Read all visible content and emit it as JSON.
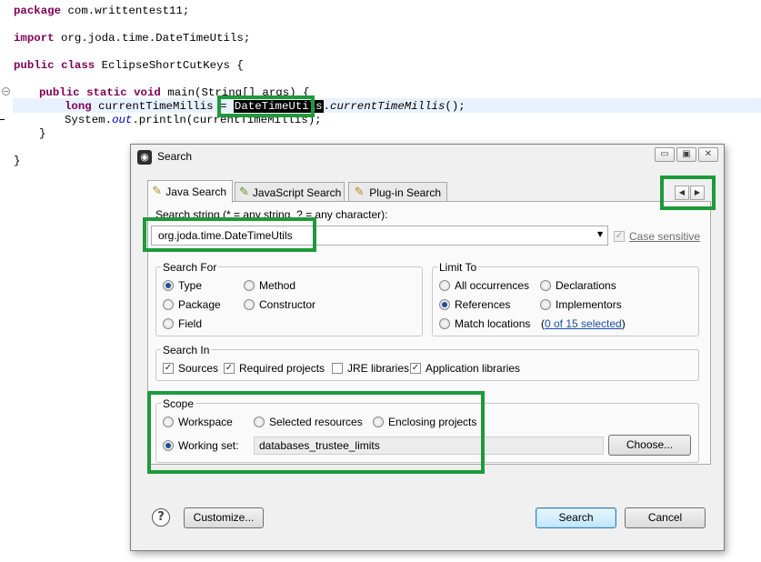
{
  "editor": {
    "lines": {
      "package_kw": "package",
      "package_name": " com.writtentest11;",
      "import_kw": "import",
      "import_name": " org.joda.time.DateTimeUtils;",
      "class_kw1": "public",
      "class_kw2": "class",
      "class_name": " EclipseShortCutKeys {",
      "main_kw1": "public",
      "main_kw2": "static",
      "main_kw3": "void",
      "main_rest": " main(String[] args) {",
      "long_kw": "long",
      "long_var": " currentTimeMillis = ",
      "selected_class": "DateTimeUtils",
      "method_call": "currentTimeMillis",
      "long_end": "();",
      "println_start": "System.",
      "println_out": "out",
      "println_end": ".println(currentTimeMillis);",
      "close_brace_inner": "}",
      "close_brace_outer": "}"
    },
    "fold_glyph": "−"
  },
  "dialog": {
    "title": "Search",
    "window_buttons": {
      "minimize": "▭",
      "maximize": "▣",
      "close": "✕"
    },
    "tabs": [
      {
        "label": "Java Search",
        "icon": "java-search-icon",
        "glyph": "✎"
      },
      {
        "label": "JavaScript Search",
        "icon": "javascript-search-icon",
        "glyph": "✎"
      },
      {
        "label": "Plug-in Search",
        "icon": "plugin-search-icon",
        "glyph": "✎"
      }
    ],
    "nav_arrows": {
      "back": "◀",
      "forward": "▶"
    },
    "search_string_label": "Search string (* = any string, ? = any character):",
    "search_string_value": "org.joda.time.DateTimeUtils",
    "combo_arrow": "▼",
    "case_sensitive": {
      "label": "Case sensitive",
      "checked": true,
      "enabled": false,
      "glyph": "✓"
    },
    "search_for": {
      "title": "Search For",
      "options": {
        "type": "Type",
        "method": "Method",
        "package": "Package",
        "constructor": "Constructor",
        "field": "Field"
      },
      "selected": "Type"
    },
    "limit_to": {
      "title": "Limit To",
      "options": {
        "all": "All occurrences",
        "declarations": "Declarations",
        "references": "References",
        "implementors": "Implementors",
        "match": "Match locations"
      },
      "selected": "References",
      "match_link": "0 of 15 selected",
      "paren_open": "(",
      "paren_close": ")"
    },
    "search_in": {
      "title": "Search In",
      "options": {
        "sources": "Sources",
        "required": "Required projects",
        "jre": "JRE libraries",
        "app": "Application libraries"
      },
      "check_glyph": "✓"
    },
    "scope": {
      "title": "Scope",
      "options": {
        "workspace": "Workspace",
        "selected": "Selected resources",
        "enclosing": "Enclosing projects",
        "working_set": "Working set:"
      },
      "selected": "Working set:",
      "working_set_value": "databases_trustee_limits",
      "choose_button": "Choose..."
    },
    "footer": {
      "help_glyph": "?",
      "customize_button": "Customize...",
      "search_button": "Search",
      "cancel_button": "Cancel"
    },
    "title_glyph": "◉"
  },
  "colors": {
    "highlight_box": "#1e9a3a",
    "keyword": "#7f0055",
    "field": "#0000c0"
  }
}
